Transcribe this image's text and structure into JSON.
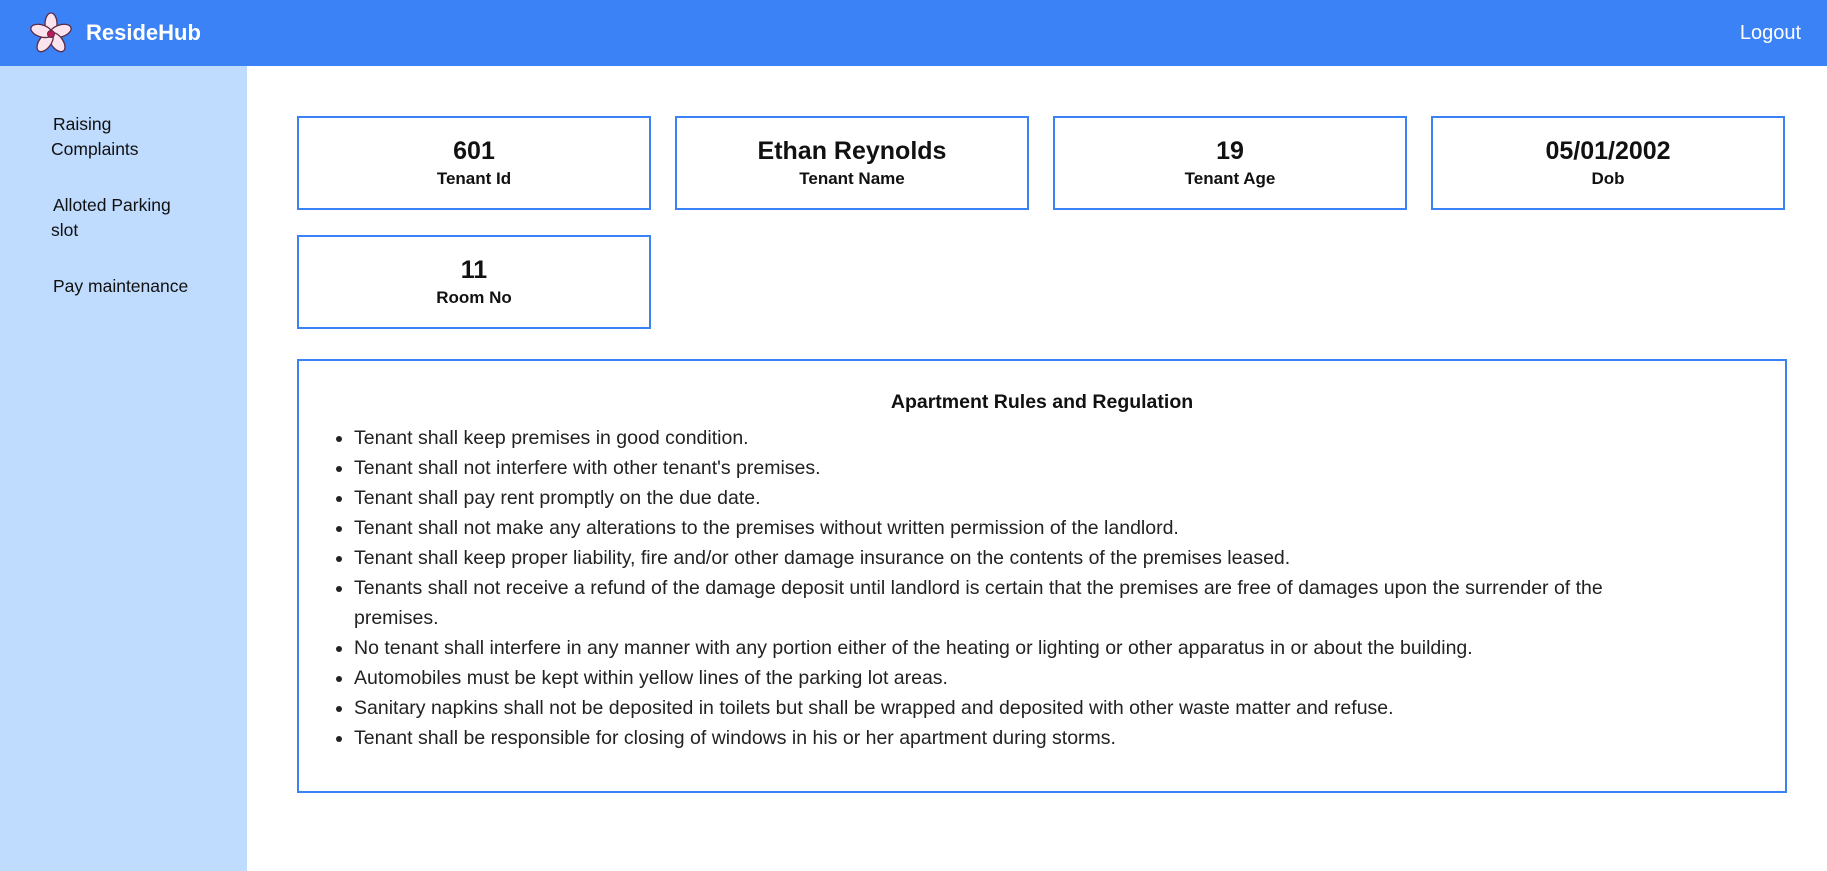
{
  "app": {
    "brand_name": "ResideHub",
    "logo_icon": "flower-logo-icon",
    "logout_label": "Logout",
    "accent_color": "#3b82f6",
    "sidebar_color": "#bfdbfe"
  },
  "sidebar": {
    "items": [
      {
        "label": "Raising Complaints"
      },
      {
        "label": "Alloted Parking slot"
      },
      {
        "label": "Pay maintenance"
      }
    ]
  },
  "cards": [
    {
      "value": "601",
      "label": "Tenant Id"
    },
    {
      "value": "Ethan Reynolds",
      "label": "Tenant Name"
    },
    {
      "value": "19",
      "label": "Tenant Age"
    },
    {
      "value": "05/01/2002",
      "label": "Dob"
    },
    {
      "value": "11",
      "label": "Room No"
    }
  ],
  "rules": {
    "title": "Apartment Rules and Regulation",
    "items": [
      "Tenant shall keep premises in good condition.",
      "Tenant shall not interfere with other tenant's premises.",
      "Tenant shall pay rent promptly on the due date.",
      "Tenant shall not make any alterations to the premises without written permission of the landlord.",
      "Tenant shall keep proper liability, fire and/or other damage insurance on the contents of the premises leased.",
      "Tenants shall not receive a refund of the damage deposit until landlord is certain that the premises are free of damages upon the surrender of the premises.",
      "No tenant shall interfere in any manner with any portion either of the heating or lighting or other apparatus in or about the building.",
      "Automobiles must be kept within yellow lines of the parking lot areas.",
      "Sanitary napkins shall not be deposited in toilets but shall be wrapped and deposited with other waste matter and refuse.",
      "Tenant shall be responsible for closing of windows in his or her apartment during storms."
    ]
  }
}
